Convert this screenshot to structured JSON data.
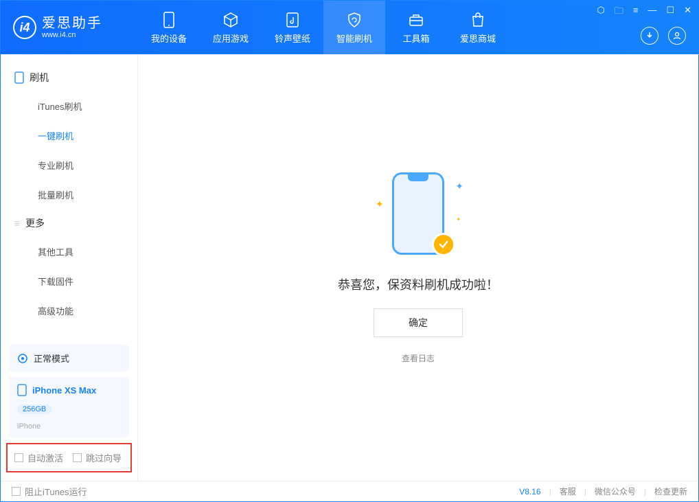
{
  "brand": {
    "name": "爱思助手",
    "url": "www.i4.cn",
    "logo_letter": "i4"
  },
  "nav": {
    "my_device": "我的设备",
    "apps_games": "应用游戏",
    "ringtones": "铃声壁纸",
    "flash": "智能刷机",
    "toolbox": "工具箱",
    "store": "爱思商城"
  },
  "sidebar": {
    "section1": "刷机",
    "items1": [
      "iTunes刷机",
      "一键刷机",
      "专业刷机",
      "批量刷机"
    ],
    "section2": "更多",
    "items2": [
      "其他工具",
      "下载固件",
      "高级功能"
    ],
    "mode": "正常模式",
    "device": {
      "name": "iPhone XS Max",
      "capacity": "256GB",
      "type": "iPhone"
    },
    "checkbox1": "自动激活",
    "checkbox2": "跳过向导"
  },
  "main": {
    "message": "恭喜您，保资料刷机成功啦！",
    "confirm": "确定",
    "view_log": "查看日志"
  },
  "footer": {
    "block_itunes": "阻止iTunes运行",
    "version": "V8.16",
    "link1": "客服",
    "link2": "微信公众号",
    "link3": "检查更新"
  }
}
